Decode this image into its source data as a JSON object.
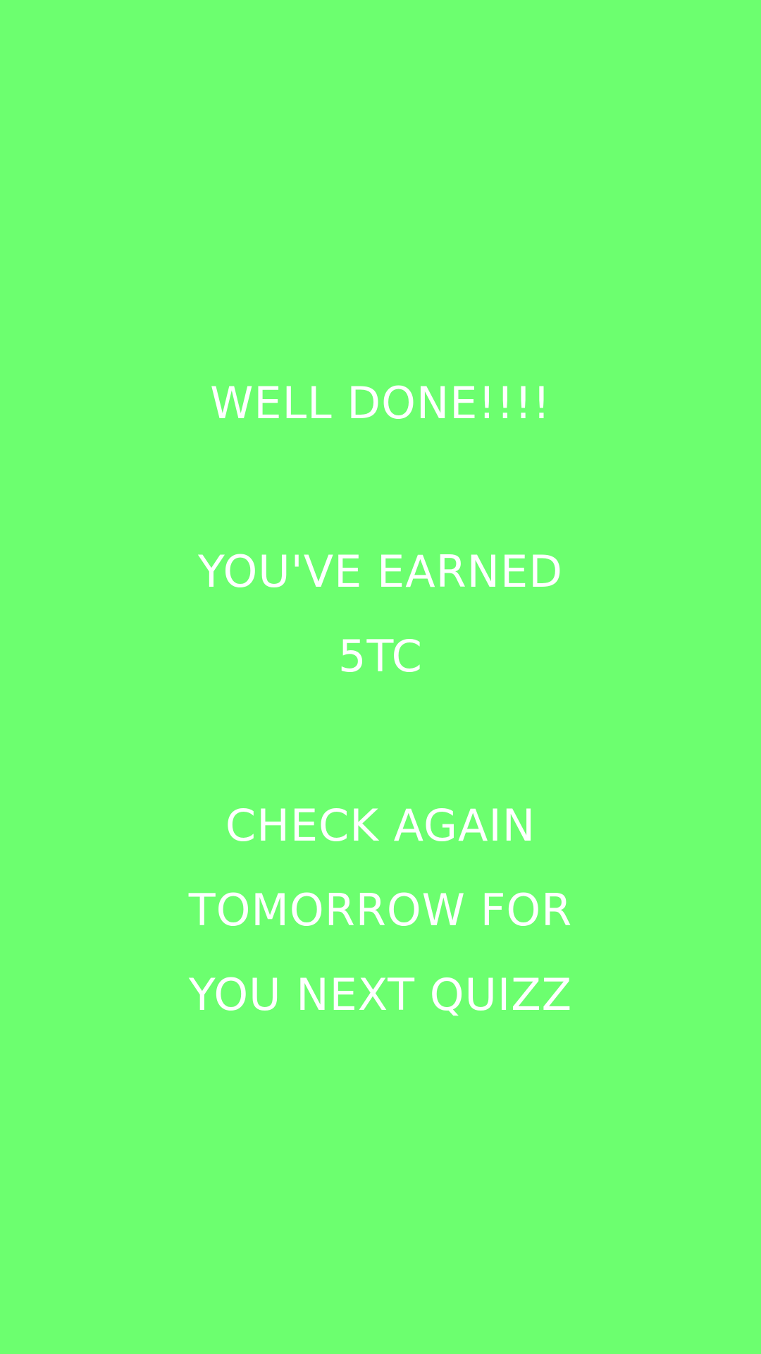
{
  "theme": {
    "background": "#6cff6f",
    "text_color": "#ffffff"
  },
  "message": {
    "headline": "WELL DONE!!!!",
    "earned_line_1": "YOU'VE EARNED",
    "earned_line_2": "5TC",
    "check_line_1": "CHECK AGAIN",
    "check_line_2": "TOMORROW FOR",
    "check_line_3": "YOU NEXT QUIZZ"
  }
}
